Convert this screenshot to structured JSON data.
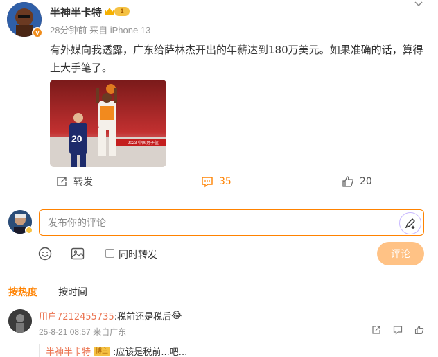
{
  "post": {
    "author": "半神半卡特",
    "level": "1",
    "verified_mark": "v",
    "time": "28分钟前",
    "source": "来自 iPhone 13",
    "text": "有外媒向我透露，广东给萨林杰开出的年薪达到180万美元。如果准确的话，算得上大手笔了。",
    "image_caption": "2023 中国男子篮",
    "image_number": "20"
  },
  "actions": {
    "repost_label": "转发",
    "comment_count": "35",
    "like_count": "20"
  },
  "composer": {
    "placeholder": "发布你的评论",
    "sync_repost_label": "同时转发",
    "submit_label": "评论"
  },
  "sort": {
    "hot_label": "按热度",
    "time_label": "按时间"
  },
  "comments": [
    {
      "user": "用户7212455735",
      "text": ":税前还是税后",
      "emoji": "😂",
      "time": "25-8-21 08:57",
      "source": "来自广东",
      "reply": {
        "user": "半神半卡特",
        "badge": "博主",
        "text": ":应该是税前...吧..."
      }
    }
  ],
  "colors": {
    "accent": "#ff8200",
    "username": "#eb7350",
    "meta": "#939393"
  }
}
